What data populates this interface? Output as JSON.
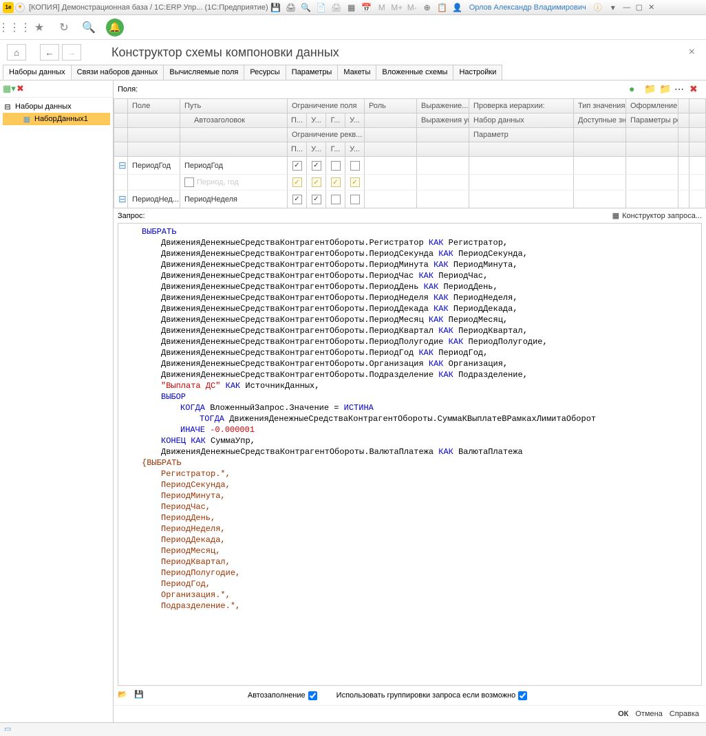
{
  "titlebar": {
    "title": "[КОПИЯ] Демонстрационная база / 1С:ERP Упр...  (1С:Предприятие)",
    "user": "Орлов Александр Владимирович"
  },
  "page": {
    "title": "Конструктор схемы компоновки данных"
  },
  "tabs": [
    {
      "label": "Наборы данных",
      "active": true
    },
    {
      "label": "Связи наборов данных"
    },
    {
      "label": "Вычисляемые поля"
    },
    {
      "label": "Ресурсы"
    },
    {
      "label": "Параметры"
    },
    {
      "label": "Макеты"
    },
    {
      "label": "Вложенные схемы"
    },
    {
      "label": "Настройки"
    }
  ],
  "tree": {
    "root": "Наборы данных",
    "item": "НаборДанных1"
  },
  "fields": {
    "label": "Поля:",
    "headers": {
      "field": "Поле",
      "path": "Путь",
      "autotitle": "Автозаголовок",
      "restrict_field": "Ограничение поля",
      "restrict_rekv": "Ограничение рекв...",
      "role": "Роль",
      "expr": "Выражение...",
      "expr_order": "Выражения упорядочив...",
      "hier_check": "Проверка иерархии:",
      "hier_nabor": "Набор данных",
      "hier_param": "Параметр",
      "type": "Тип значения",
      "avail": "Доступные значения",
      "format": "Оформление",
      "format_params": "Параметры редактиров...",
      "p": "П...",
      "u": "У...",
      "g": "Г...",
      "u2": "У..."
    },
    "rows": [
      {
        "field": "ПериодГод",
        "path": "ПериодГод",
        "sub": "Период, год",
        "c1": true,
        "c2": true,
        "c3": false,
        "c4": false
      },
      {
        "field": "ПериодНед...",
        "path": "ПериодНеделя"
      }
    ]
  },
  "query": {
    "label": "Запрос:",
    "constructor_link": "Конструктор запроса...",
    "tokens": [
      [
        "kw-blue",
        "ВЫБРАТЬ",
        1
      ],
      [
        "mix",
        "ДвиженияДенежныеСредстваКонтрагентОбороты.Регистратор |КАК| Регистратор,",
        2
      ],
      [
        "mix",
        "ДвиженияДенежныеСредстваКонтрагентОбороты.ПериодСекунда |КАК| ПериодСекунда,",
        2
      ],
      [
        "mix",
        "ДвиженияДенежныеСредстваКонтрагентОбороты.ПериодМинута |КАК| ПериодМинута,",
        2
      ],
      [
        "mix",
        "ДвиженияДенежныеСредстваКонтрагентОбороты.ПериодЧас |КАК| ПериодЧас,",
        2
      ],
      [
        "mix",
        "ДвиженияДенежныеСредстваКонтрагентОбороты.ПериодДень |КАК| ПериодДень,",
        2
      ],
      [
        "mix",
        "ДвиженияДенежныеСредстваКонтрагентОбороты.ПериодНеделя |КАК| ПериодНеделя,",
        2
      ],
      [
        "mix",
        "ДвиженияДенежныеСредстваКонтрагентОбороты.ПериодДекада |КАК| ПериодДекада,",
        2
      ],
      [
        "mix",
        "ДвиженияДенежныеСредстваКонтрагентОбороты.ПериодМесяц |КАК| ПериодМесяц,",
        2
      ],
      [
        "mix",
        "ДвиженияДенежныеСредстваКонтрагентОбороты.ПериодКвартал |КАК| ПериодКвартал,",
        2
      ],
      [
        "mix",
        "ДвиженияДенежныеСредстваКонтрагентОбороты.ПериодПолугодие |КАК| ПериодПолугодие,",
        2
      ],
      [
        "mix",
        "ДвиженияДенежныеСредстваКонтрагентОбороты.ПериодГод |КАК| ПериодГод,",
        2
      ],
      [
        "mix",
        "ДвиженияДенежныеСредстваКонтрагентОбороты.Организация |КАК| Организация,",
        2
      ],
      [
        "mix",
        "ДвиженияДенежныеСредстваКонтрагентОбороты.Подразделение |КАК| Подразделение,",
        2
      ],
      [
        "mix-red",
        "~\"Выплата ДС\"~ |КАК| ИсточникДанных,",
        2
      ],
      [
        "kw-blue",
        "ВЫБОР",
        2
      ],
      [
        "mix-when",
        "|КОГДА| ВложенныйЗапрос.Значение = |ИСТИНА|",
        3
      ],
      [
        "mix-then",
        "|ТОГДА| ДвиженияДенежныеСредстваКонтрагентОбороты.СуммаКВыплатеВРамкахЛимитаОборот",
        4
      ],
      [
        "mix-else",
        "|ИНАЧЕ| ~-0.000001~",
        3
      ],
      [
        "mix-end",
        "|КОНЕЦ| |КАК| СуммаУпр,",
        2
      ],
      [
        "mix",
        "ДвиженияДенежныеСредстваКонтрагентОбороты.ВалютаПлатежа |КАК| ВалютаПлатежа",
        2
      ],
      [
        "kw-brown",
        "{ВЫБРАТЬ",
        1
      ],
      [
        "kw-brown",
        "Регистратор.*,",
        2
      ],
      [
        "kw-brown",
        "ПериодСекунда,",
        2
      ],
      [
        "kw-brown",
        "ПериодМинута,",
        2
      ],
      [
        "kw-brown",
        "ПериодЧас,",
        2
      ],
      [
        "kw-brown",
        "ПериодДень,",
        2
      ],
      [
        "kw-brown",
        "ПериодНеделя,",
        2
      ],
      [
        "kw-brown",
        "ПериодДекада,",
        2
      ],
      [
        "kw-brown",
        "ПериодМесяц,",
        2
      ],
      [
        "kw-brown",
        "ПериодКвартал,",
        2
      ],
      [
        "kw-brown",
        "ПериодПолугодие,",
        2
      ],
      [
        "kw-brown",
        "ПериодГод,",
        2
      ],
      [
        "kw-brown",
        "Организация.*,",
        2
      ],
      [
        "kw-brown",
        "Подразделение.*,",
        2
      ]
    ]
  },
  "bottom": {
    "autofill": "Автозаполнение",
    "use_groupings": "Использовать группировки запроса если возможно"
  },
  "footer": {
    "ok": "ОК",
    "cancel": "Отмена",
    "help": "Справка"
  }
}
